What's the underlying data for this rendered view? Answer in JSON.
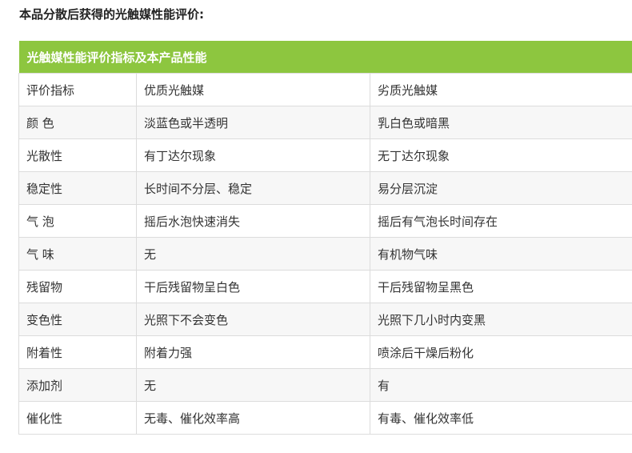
{
  "intro": "本品分散后获得的光触媒性能评价:",
  "table": {
    "title": "光触媒性能评价指标及本产品性能",
    "rows": [
      [
        "评价指标",
        "优质光触媒",
        "劣质光触媒"
      ],
      [
        "颜 色",
        "淡蓝色或半透明",
        "乳白色或暗黑"
      ],
      [
        "光散性",
        "有丁达尔现象",
        "无丁达尔现象"
      ],
      [
        "稳定性",
        "长时间不分层、稳定",
        "易分层沉淀"
      ],
      [
        "气 泡",
        "摇后水泡快速消失",
        "摇后有气泡长时间存在"
      ],
      [
        "气 味",
        "无",
        "有机物气味"
      ],
      [
        "残留物",
        "干后残留物呈白色",
        "干后残留物呈黑色"
      ],
      [
        "变色性",
        "光照下不会变色",
        "光照下几小时内变黑"
      ],
      [
        "附着性",
        "附着力强",
        "喷涂后干燥后粉化"
      ],
      [
        "添加剂",
        "无",
        "有"
      ],
      [
        "催化性",
        "无毒、催化效率高",
        "有毒、催化效率低"
      ]
    ]
  },
  "colors": {
    "header_bg": "#8dc63f",
    "header_text": "#ffffff",
    "border": "#dcdcdc"
  }
}
